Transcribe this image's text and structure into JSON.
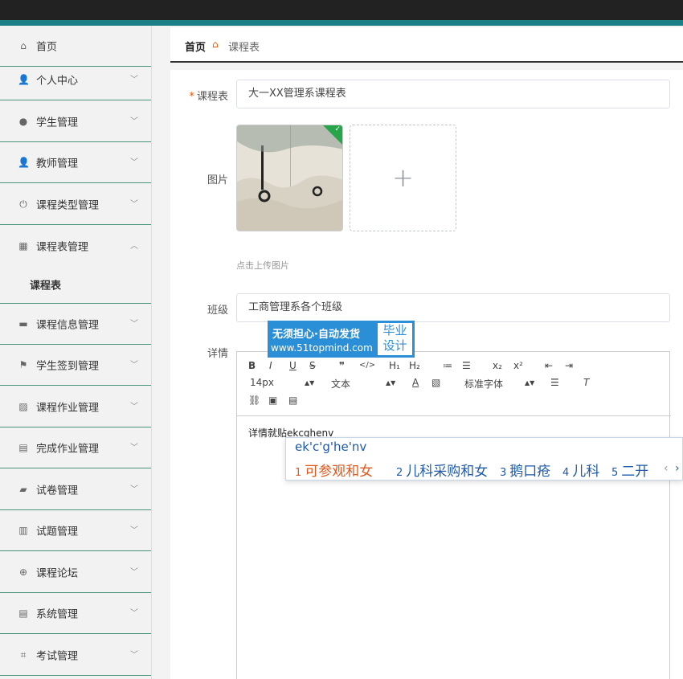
{
  "sidebar": {
    "items": [
      {
        "label": "首页",
        "icon": "home-icon",
        "glyph": "⌂",
        "arrow": ""
      },
      {
        "label": "个人中心",
        "icon": "user-icon",
        "glyph": "👤",
        "arrow": "﹀"
      },
      {
        "label": "学生管理",
        "icon": "pin-icon",
        "glyph": "●",
        "arrow": "﹀"
      },
      {
        "label": "教师管理",
        "icon": "teacher-icon",
        "glyph": "👤",
        "arrow": "﹀"
      },
      {
        "label": "课程类型管理",
        "icon": "power-icon",
        "glyph": "⏻",
        "arrow": "﹀"
      },
      {
        "label": "课程表管理",
        "icon": "grid-icon",
        "glyph": "▦",
        "arrow": "︿"
      },
      {
        "label": "课程信息管理",
        "icon": "briefcase-icon",
        "glyph": "▬",
        "arrow": "﹀"
      },
      {
        "label": "学生签到管理",
        "icon": "flag-icon",
        "glyph": "⚑",
        "arrow": "﹀"
      },
      {
        "label": "课程作业管理",
        "icon": "chart-icon",
        "glyph": "▨",
        "arrow": "﹀"
      },
      {
        "label": "完成作业管理",
        "icon": "clipboard-icon",
        "glyph": "▤",
        "arrow": "﹀"
      },
      {
        "label": "试卷管理",
        "icon": "folder-icon",
        "glyph": "▰",
        "arrow": "﹀"
      },
      {
        "label": "试题管理",
        "icon": "sign-icon",
        "glyph": "▥",
        "arrow": "﹀"
      },
      {
        "label": "课程论坛",
        "icon": "compass-icon",
        "glyph": "⊕",
        "arrow": "﹀"
      },
      {
        "label": "系统管理",
        "icon": "document-icon",
        "glyph": "▤",
        "arrow": "﹀"
      },
      {
        "label": "考试管理",
        "icon": "crop-icon",
        "glyph": "⌗",
        "arrow": "﹀"
      }
    ],
    "submenu": {
      "label": "课程表"
    }
  },
  "breadcrumb": {
    "home": "首页",
    "current": "课程表",
    "icon": "home-icon"
  },
  "form": {
    "required_mark": "*",
    "course_label": "课程表",
    "course_value": "大一XX管理系课程表",
    "image_label": "图片",
    "upload_hint": "点击上传图片",
    "upload_plus": "+",
    "class_label": "班级",
    "class_value": "工商管理系各个班级",
    "detail_label": "详情"
  },
  "promo": {
    "title": "无须担心·自动发货",
    "url": "www.51topmind.com",
    "badge_line1": "毕业",
    "badge_line2": "设计"
  },
  "editor": {
    "toolbar_row1": [
      "B",
      "I",
      "U",
      "S",
      "❞",
      "</>",
      "H₁",
      "H₂",
      "≔",
      "☰",
      "x₂",
      "x²",
      "⇤",
      "⇥"
    ],
    "font_size": "14px",
    "text_type": "文本",
    "font_family": "标准字体",
    "content": "详情就贴ekcghenv"
  },
  "ime": {
    "composition": "ek'c'g'he'nv",
    "candidates": [
      {
        "num": "1",
        "text": "可参观和女"
      },
      {
        "num": "2",
        "text": "儿科采购和女"
      },
      {
        "num": "3",
        "text": "鹅口疮"
      },
      {
        "num": "4",
        "text": "儿科"
      },
      {
        "num": "5",
        "text": "二开"
      }
    ],
    "prev": "‹",
    "next": "›"
  }
}
